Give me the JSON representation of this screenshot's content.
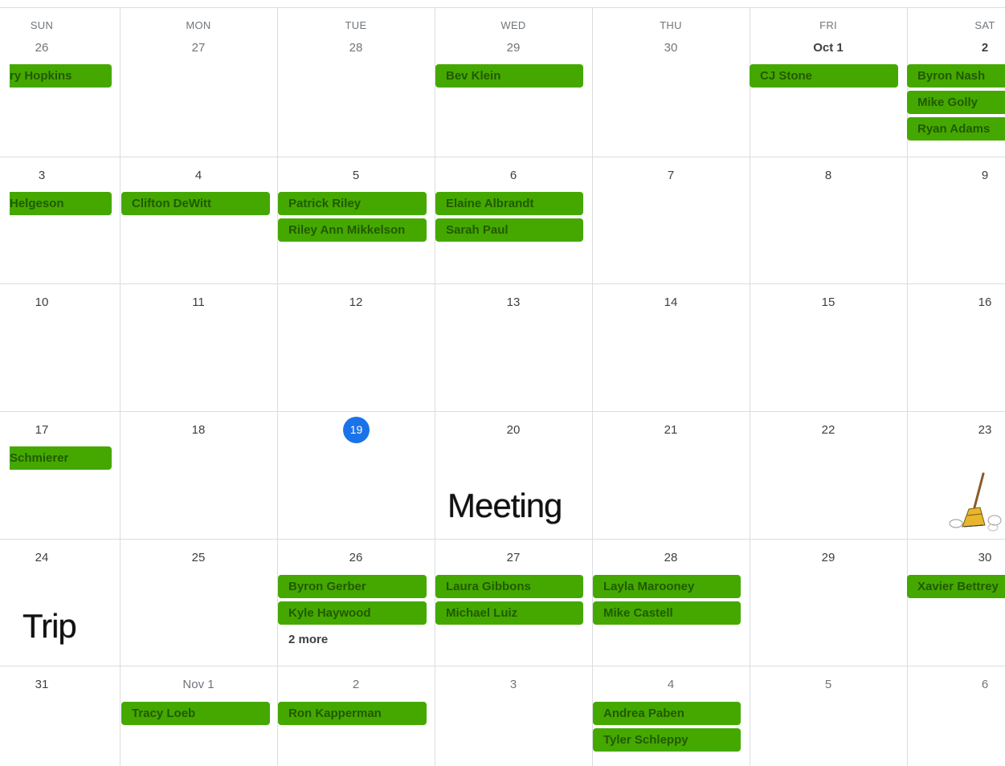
{
  "weekdays": [
    "SUN",
    "MON",
    "TUE",
    "WED",
    "THU",
    "FRI",
    "SAT"
  ],
  "weeks": [
    {
      "days": [
        "26",
        "27",
        "28",
        "29",
        "30",
        "Oct 1",
        "2"
      ]
    },
    {
      "days": [
        "3",
        "4",
        "5",
        "6",
        "7",
        "8",
        "9"
      ]
    },
    {
      "days": [
        "10",
        "11",
        "12",
        "13",
        "14",
        "15",
        "16"
      ]
    },
    {
      "days": [
        "17",
        "18",
        "19",
        "20",
        "21",
        "22",
        "23"
      ]
    },
    {
      "days": [
        "24",
        "25",
        "26",
        "27",
        "28",
        "29",
        "30"
      ]
    },
    {
      "days": [
        "31",
        "Nov 1",
        "2",
        "3",
        "4",
        "5",
        "6"
      ]
    }
  ],
  "today": "19",
  "events": {
    "w0_sun": [
      "ry Hopkins"
    ],
    "w0_wed": [
      "Bev Klein"
    ],
    "w0_fri": [
      "CJ Stone"
    ],
    "w0_sat": [
      "Byron Nash",
      "Mike Golly",
      "Ryan Adams"
    ],
    "w1_sun": [
      "Helgeson"
    ],
    "w1_mon": [
      "Clifton DeWitt"
    ],
    "w1_tue": [
      "Patrick Riley",
      "Riley Ann Mikkelson"
    ],
    "w1_wed": [
      "Elaine Albrandt",
      "Sarah Paul"
    ],
    "w3_sun": [
      "Schmierer"
    ],
    "w4_tue": [
      "Byron Gerber",
      "Kyle Haywood"
    ],
    "w4_tue_more": "2 more",
    "w4_wed": [
      "Laura Gibbons",
      "Michael Luiz"
    ],
    "w4_thu": [
      "Layla Marooney",
      "Mike Castell"
    ],
    "w4_sat": [
      "Xavier Bettrey"
    ],
    "w5_mon": [
      "Tracy Loeb"
    ],
    "w5_tue": [
      "Ron Kapperman"
    ],
    "w5_thu": [
      "Andrea Paben",
      "Tyler Schleppy"
    ]
  },
  "stickers": {
    "meeting": "Meeting",
    "trip": "Trip",
    "broom_icon": "broom-icon"
  },
  "colors": {
    "event_bg": "#45a800",
    "event_text": "#215a00",
    "today_bg": "#1a73e8",
    "grid": "#dadce0"
  }
}
